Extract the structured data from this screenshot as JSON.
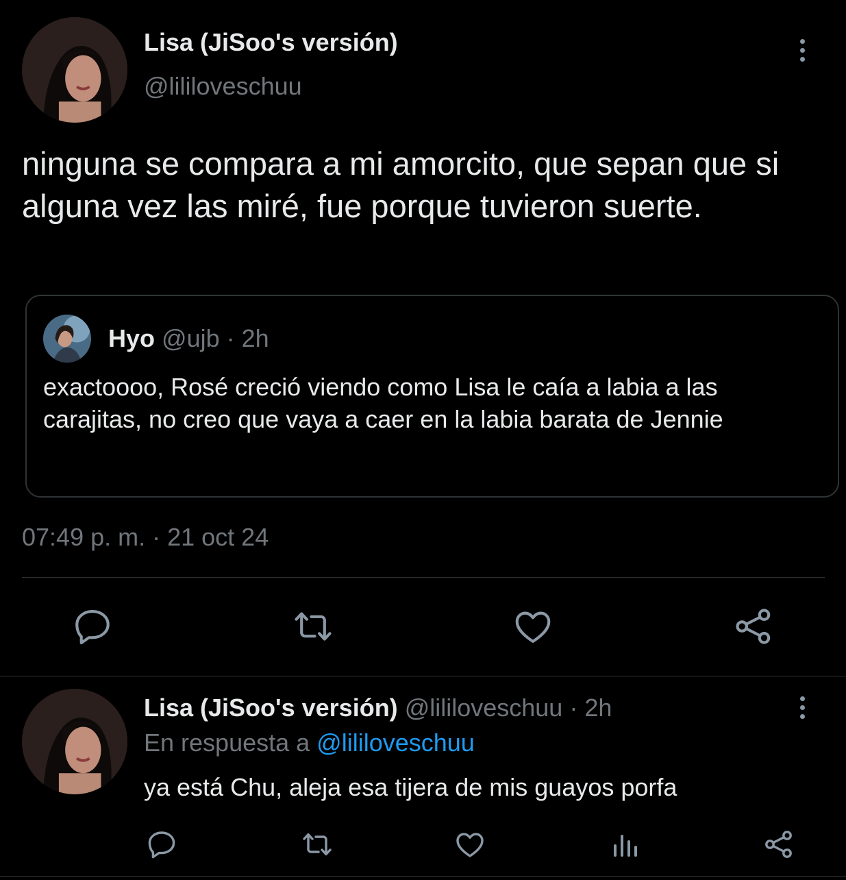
{
  "tweet": {
    "author_name": "Lisa (JiSoo's versión)",
    "author_handle": "@lililoveschuu",
    "text": "ninguna se compara a mi amorcito, que sepan que si alguna vez las miré, fue porque tuvieron suerte.",
    "quote": {
      "name": "Hyo",
      "handle": "@ujb",
      "time": "· 2h",
      "text": "exactoooo, Rosé creció viendo como Lisa le caía a labia a las carajitas, no creo que vaya a caer en la labia barata de Jennie"
    },
    "timestamp": "07:49 p. m. · 21 oct 24",
    "actions": [
      "reply-icon",
      "retweet-icon",
      "like-icon",
      "share-icon"
    ]
  },
  "reply": {
    "author_name": "Lisa (JiSoo's versión)",
    "author_handle": "@lililoveschuu",
    "time": "· 2h",
    "replying_prefix": "En respuesta a",
    "replying_to": "@lililoveschuu",
    "text": "ya está Chu, aleja esa tijera de mis guayos porfa",
    "actions": [
      "reply-icon",
      "retweet-icon",
      "like-icon",
      "analytics-icon",
      "share-icon"
    ]
  },
  "colors": {
    "background": "#000000",
    "text": "#e7e9ea",
    "muted": "#71767b",
    "link": "#1d9bf0",
    "border": "#2f3336"
  }
}
